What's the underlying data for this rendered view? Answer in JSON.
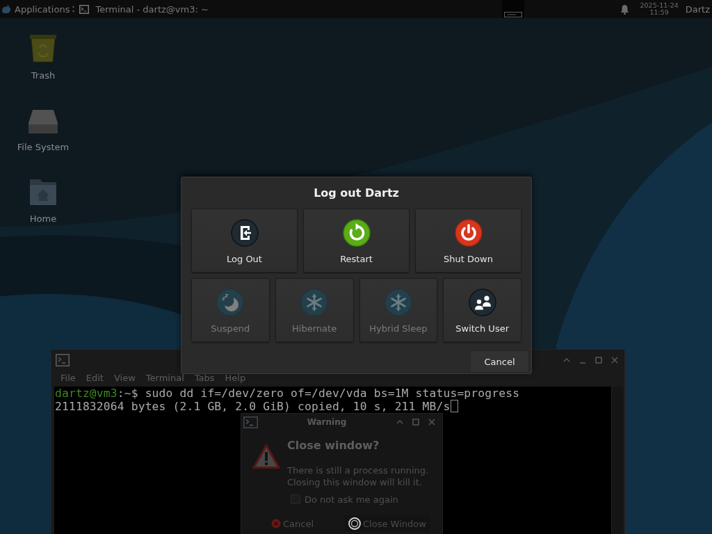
{
  "top_panel": {
    "app_menu": "Applications",
    "task_button": {
      "title": "Terminal - dartz@vm3: ~"
    },
    "clock": {
      "date": "2025-11-24",
      "time": "11:59"
    },
    "user": "Dartz"
  },
  "desktop_icons": [
    {
      "kind": "trash",
      "label": "Trash"
    },
    {
      "kind": "drive",
      "label": "File System"
    },
    {
      "kind": "home",
      "label": "Home"
    }
  ],
  "logout_dialog": {
    "title": "Log out Dartz",
    "action_rows": [
      {
        "actions": [
          {
            "kind": "log_out",
            "label": "Log Out",
            "disabled": false
          },
          {
            "kind": "restart",
            "label": "Restart",
            "disabled": false
          },
          {
            "kind": "shut_down",
            "label": "Shut Down",
            "disabled": false
          }
        ]
      },
      {
        "actions": [
          {
            "kind": "suspend",
            "label": "Suspend",
            "disabled": true
          },
          {
            "kind": "hibernate",
            "label": "Hibernate",
            "disabled": true
          },
          {
            "kind": "hybrid_sleep",
            "label": "Hybrid Sleep",
            "disabled": true
          },
          {
            "kind": "switch_user",
            "label": "Switch User",
            "disabled": false
          }
        ]
      }
    ],
    "cancel": "Cancel"
  },
  "terminal": {
    "menu": [
      "File",
      "Edit",
      "View",
      "Terminal",
      "Tabs",
      "Help"
    ],
    "lines": [
      {
        "prompt": "dartz@vm3",
        "text": ":~$ sudo dd if=/dev/zero of=/dev/vda bs=1M status=progress",
        "cursor": false
      },
      {
        "text": "2111832064 bytes (2.1 GB, 2.0 GiB) copied, 10 s, 211 MB/s",
        "cursor": true
      }
    ]
  },
  "warning_dialog": {
    "title": "Warning",
    "heading": "Close window?",
    "message": "There is still a process running. Closing this window will kill it.",
    "checkbox": {
      "label": "Do not ask me again",
      "checked": false
    },
    "buttons": [
      {
        "kind": "cancel",
        "label": "Cancel"
      },
      {
        "kind": "close",
        "label": "Close Window"
      }
    ]
  }
}
